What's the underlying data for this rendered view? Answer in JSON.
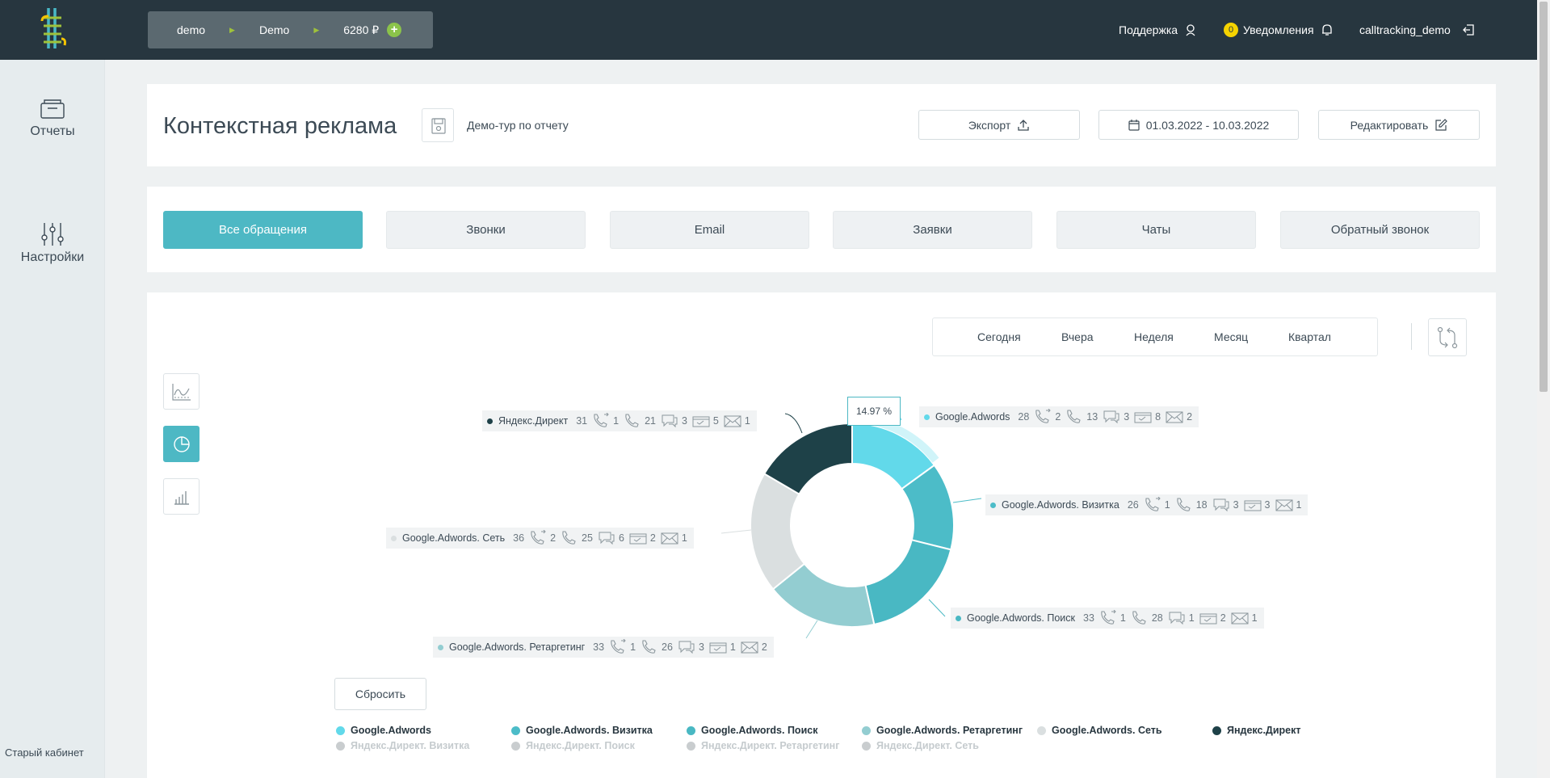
{
  "header": {
    "account": {
      "login": "demo",
      "project": "Demo",
      "balance": "6280 ₽",
      "add_symbol": "+"
    },
    "support_label": "Поддержка",
    "notifications_count": "0",
    "notifications_label": "Уведомления",
    "username": "calltracking_demo"
  },
  "sidebar": {
    "reports_label": "Отчеты",
    "settings_label": "Настройки",
    "old_cabinet_label": "Старый кабинет"
  },
  "report": {
    "title": "Контекстная реклама",
    "demo_tour_label": "Демо-тур по отчету",
    "export_label": "Экспорт",
    "date_range": "01.03.2022 - 10.03.2022",
    "edit_label": "Редактировать"
  },
  "tabs": [
    "Все обращения",
    "Звонки",
    "Email",
    "Заявки",
    "Чаты",
    "Обратный звонок"
  ],
  "periods": [
    "Сегодня",
    "Вчера",
    "Неделя",
    "Месяц",
    "Квартал"
  ],
  "tooltip": "14.97 %",
  "reset_label": "Сбросить",
  "colors": {
    "accent": "#4db8c4",
    "topbar": "#27363f"
  },
  "chart_data": {
    "type": "pie",
    "donut": true,
    "series": [
      {
        "name": "Google.Adwords",
        "total": 28,
        "callback_calls": 2,
        "calls": 13,
        "chats": 3,
        "requests": 8,
        "emails": 2,
        "color": "#62d9ea"
      },
      {
        "name": "Google.Adwords. Визитка",
        "total": 26,
        "callback_calls": 1,
        "calls": 18,
        "chats": 3,
        "requests": 3,
        "emails": 1,
        "color": "#4cbcc8"
      },
      {
        "name": "Google.Adwords. Поиск",
        "total": 33,
        "callback_calls": 1,
        "calls": 28,
        "chats": 1,
        "requests": 2,
        "emails": 1,
        "color": "#49b8c3"
      },
      {
        "name": "Google.Adwords. Ретаргетинг",
        "total": 33,
        "callback_calls": 1,
        "calls": 26,
        "chats": 3,
        "requests": 1,
        "emails": 2,
        "color": "#93cdd1"
      },
      {
        "name": "Google.Adwords. Сеть",
        "total": 36,
        "callback_calls": 2,
        "calls": 25,
        "chats": 6,
        "requests": 2,
        "emails": 1,
        "color": "#dadfe0"
      },
      {
        "name": "Яндекс.Директ",
        "total": 31,
        "callback_calls": 1,
        "calls": 21,
        "chats": 3,
        "requests": 5,
        "emails": 1,
        "color": "#1e4148"
      }
    ],
    "legend": {
      "active": [
        "Google.Adwords",
        "Google.Adwords. Визитка",
        "Google.Adwords. Поиск",
        "Google.Adwords. Ретаргетинг",
        "Google.Adwords. Сеть",
        "Яндекс.Директ"
      ],
      "inactive": [
        "Яндекс.Директ. Визитка",
        "Яндекс.Директ. Поиск",
        "Яндекс.Директ. Ретаргетинг",
        "Яндекс.Директ. Сеть"
      ],
      "inactive_color": "#c9cdcf"
    }
  }
}
